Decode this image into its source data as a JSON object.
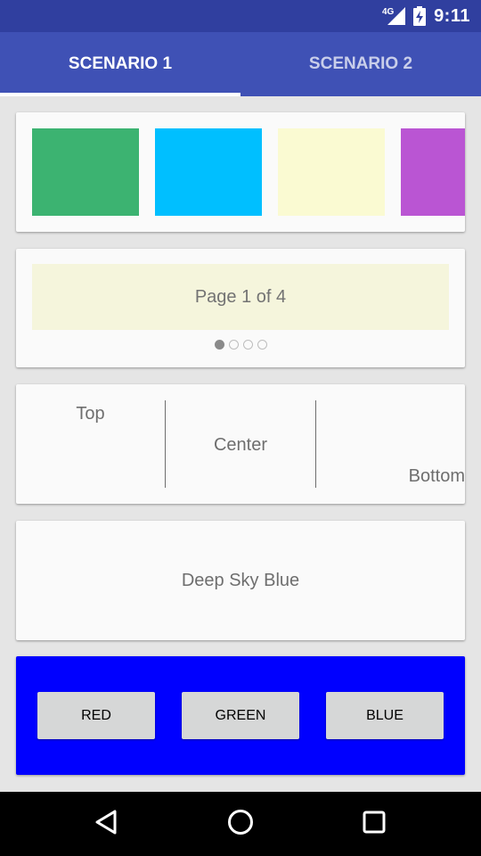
{
  "status_bar": {
    "time": "9:11",
    "network_label": "4G",
    "icons": [
      "signal-4g-icon",
      "battery-charging-icon"
    ]
  },
  "tabs": [
    {
      "label": "SCENARIO 1",
      "active": true
    },
    {
      "label": "SCENARIO 2",
      "active": false
    }
  ],
  "carousel": {
    "swatch_colors": [
      "#3cb371",
      "#00bfff",
      "#fafad2",
      "#ba55d3"
    ]
  },
  "pager": {
    "label": "Page 1 of 4",
    "current_page": 1,
    "total_pages": 4
  },
  "alignment": {
    "top_label": "Top",
    "center_label": "Center",
    "bottom_label": "Bottom"
  },
  "color_display": {
    "label": "Deep Sky Blue"
  },
  "color_buttons": {
    "panel_color": "#0000ff",
    "red_label": "RED",
    "green_label": "GREEN",
    "blue_label": "BLUE"
  },
  "nav_bar": {
    "icons": [
      "back-icon",
      "home-icon",
      "recents-icon"
    ]
  }
}
